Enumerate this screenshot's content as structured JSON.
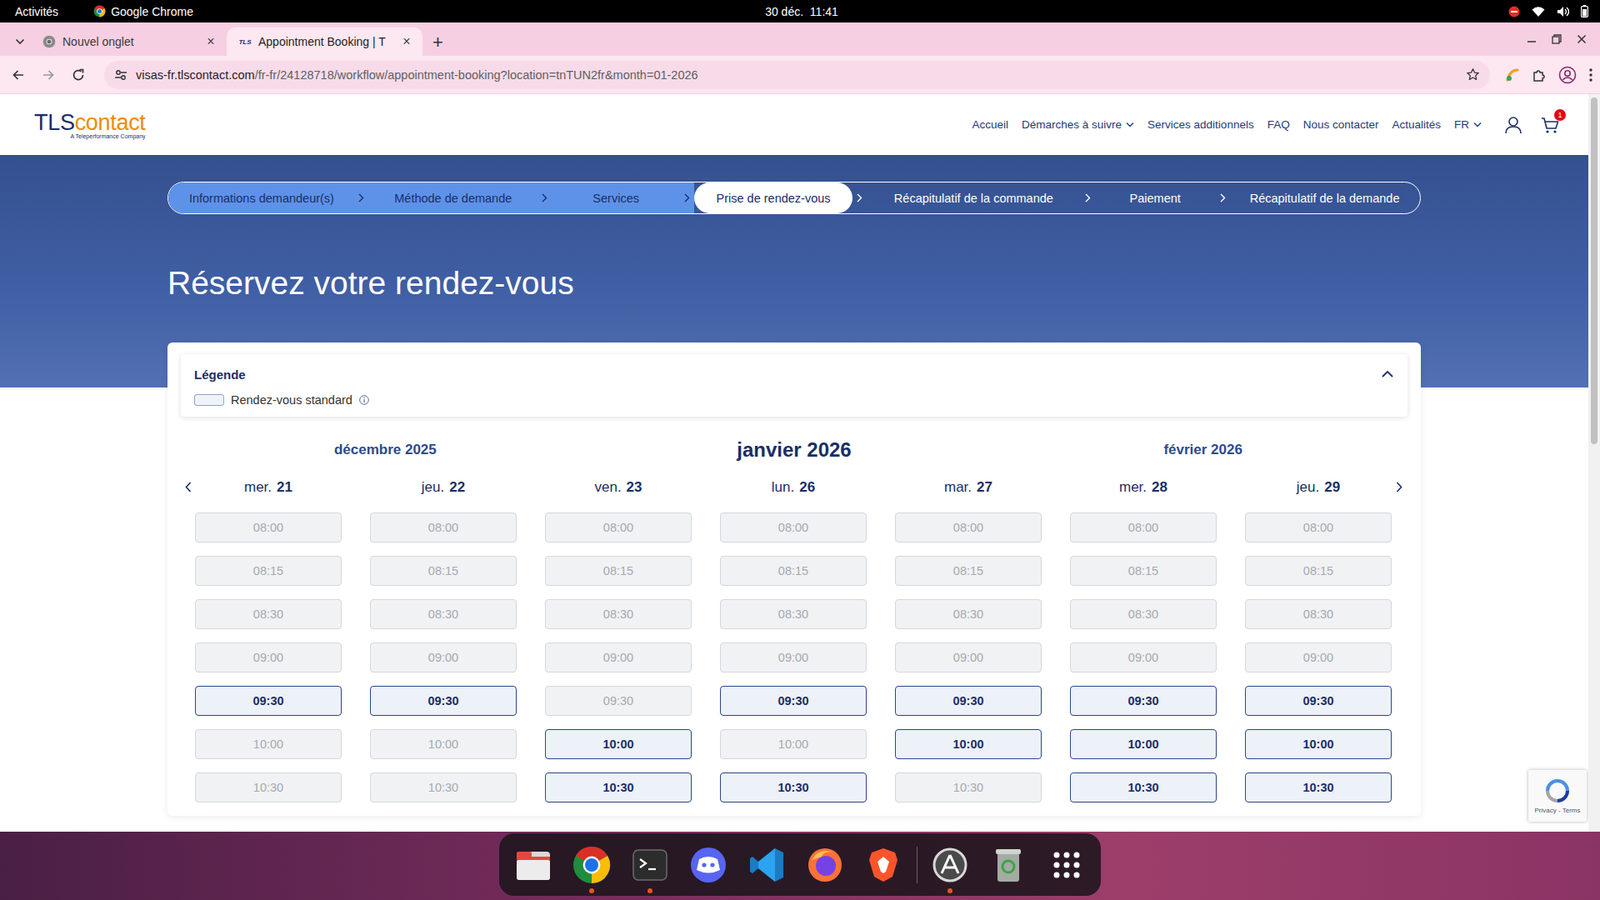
{
  "desktop": {
    "activities": "Activités",
    "app": "Google Chrome",
    "clock": "30 déc.  11:41"
  },
  "browser": {
    "tabs": [
      {
        "label": "Nouvel onglet",
        "close": "×",
        "selected": false
      },
      {
        "favicon_text": "TLS",
        "label": "Appointment Booking | T",
        "close": "×",
        "selected": true
      }
    ],
    "new_tab": "+",
    "url": {
      "host": "visas-fr.tlscontact.com",
      "path": "/fr-fr/24128718/workflow/appointment-booking?location=tnTUN2fr&month=01-2026"
    }
  },
  "site": {
    "logo": {
      "mark": "TLS",
      "word": "contact",
      "tagline": "A Teleperformance Company"
    },
    "nav": [
      {
        "label": "Accueil",
        "kind": "link"
      },
      {
        "label": "Démarches à suivre",
        "kind": "menu"
      },
      {
        "label": "Services additionnels",
        "kind": "link"
      },
      {
        "label": "FAQ",
        "kind": "link"
      },
      {
        "label": "Nous contacter",
        "kind": "link"
      },
      {
        "label": "Actualités",
        "kind": "link"
      },
      {
        "label": "FR",
        "kind": "menu"
      }
    ],
    "cart_count": "1"
  },
  "steps": [
    {
      "label": "Informations demandeur(s)",
      "completed": true,
      "selected": false
    },
    {
      "label": "Méthode de demande",
      "completed": true,
      "selected": false
    },
    {
      "label": "Services",
      "completed": true,
      "selected": false
    },
    {
      "label": "Prise de rendez-vous",
      "completed": false,
      "selected": true
    },
    {
      "label": "Récapitulatif de la commande",
      "completed": false,
      "selected": false
    },
    {
      "label": "Paiement",
      "completed": false,
      "selected": false
    },
    {
      "label": "Récapitulatif de la demande",
      "completed": false,
      "selected": false
    }
  ],
  "title": "Réservez votre rendez-vous",
  "legend": {
    "title": "Légende",
    "expanded": true,
    "items": [
      {
        "label": "Rendez-vous standard"
      }
    ]
  },
  "calendar": {
    "months": [
      {
        "label": "décembre 2025",
        "current": false
      },
      {
        "label": "janvier 2026",
        "current": true
      },
      {
        "label": "février 2026",
        "current": false
      }
    ],
    "days": [
      {
        "weekday": "mer.",
        "date": "21",
        "slots": [
          {
            "time": "08:00",
            "available": false
          },
          {
            "time": "08:15",
            "available": false
          },
          {
            "time": "08:30",
            "available": false
          },
          {
            "time": "09:00",
            "available": false
          },
          {
            "time": "09:30",
            "available": true
          },
          {
            "time": "10:00",
            "available": false
          },
          {
            "time": "10:30",
            "available": false
          }
        ]
      },
      {
        "weekday": "jeu.",
        "date": "22",
        "slots": [
          {
            "time": "08:00",
            "available": false
          },
          {
            "time": "08:15",
            "available": false
          },
          {
            "time": "08:30",
            "available": false
          },
          {
            "time": "09:00",
            "available": false
          },
          {
            "time": "09:30",
            "available": true
          },
          {
            "time": "10:00",
            "available": false
          },
          {
            "time": "10:30",
            "available": false
          }
        ]
      },
      {
        "weekday": "ven.",
        "date": "23",
        "slots": [
          {
            "time": "08:00",
            "available": false
          },
          {
            "time": "08:15",
            "available": false
          },
          {
            "time": "08:30",
            "available": false
          },
          {
            "time": "09:00",
            "available": false
          },
          {
            "time": "09:30",
            "available": false
          },
          {
            "time": "10:00",
            "available": true
          },
          {
            "time": "10:30",
            "available": true
          }
        ]
      },
      {
        "weekday": "lun.",
        "date": "26",
        "slots": [
          {
            "time": "08:00",
            "available": false
          },
          {
            "time": "08:15",
            "available": false
          },
          {
            "time": "08:30",
            "available": false
          },
          {
            "time": "09:00",
            "available": false
          },
          {
            "time": "09:30",
            "available": true
          },
          {
            "time": "10:00",
            "available": false
          },
          {
            "time": "10:30",
            "available": true
          }
        ]
      },
      {
        "weekday": "mar.",
        "date": "27",
        "slots": [
          {
            "time": "08:00",
            "available": false
          },
          {
            "time": "08:15",
            "available": false
          },
          {
            "time": "08:30",
            "available": false
          },
          {
            "time": "09:00",
            "available": false
          },
          {
            "time": "09:30",
            "available": true
          },
          {
            "time": "10:00",
            "available": true
          },
          {
            "time": "10:30",
            "available": false
          }
        ]
      },
      {
        "weekday": "mer.",
        "date": "28",
        "slots": [
          {
            "time": "08:00",
            "available": false
          },
          {
            "time": "08:15",
            "available": false
          },
          {
            "time": "08:30",
            "available": false
          },
          {
            "time": "09:00",
            "available": false
          },
          {
            "time": "09:30",
            "available": true
          },
          {
            "time": "10:00",
            "available": true
          },
          {
            "time": "10:30",
            "available": true
          }
        ]
      },
      {
        "weekday": "jeu.",
        "date": "29",
        "slots": [
          {
            "time": "08:00",
            "available": false
          },
          {
            "time": "08:15",
            "available": false
          },
          {
            "time": "08:30",
            "available": false
          },
          {
            "time": "09:00",
            "available": false
          },
          {
            "time": "09:30",
            "available": true
          },
          {
            "time": "10:00",
            "available": true
          },
          {
            "time": "10:30",
            "available": true
          }
        ]
      }
    ]
  },
  "recaptcha": {
    "links": "Privacy - Terms"
  },
  "dock": {
    "items": [
      {
        "kind": "files",
        "running": false
      },
      {
        "kind": "chrome",
        "running": true
      },
      {
        "kind": "terminal",
        "running": true
      },
      {
        "kind": "discord",
        "running": false
      },
      {
        "kind": "vscode",
        "running": false
      },
      {
        "kind": "firefox",
        "running": false
      },
      {
        "kind": "brave",
        "running": false
      },
      {
        "kind": "software",
        "running": true
      },
      {
        "kind": "trash",
        "running": false
      },
      {
        "kind": "apps",
        "running": false
      }
    ]
  }
}
